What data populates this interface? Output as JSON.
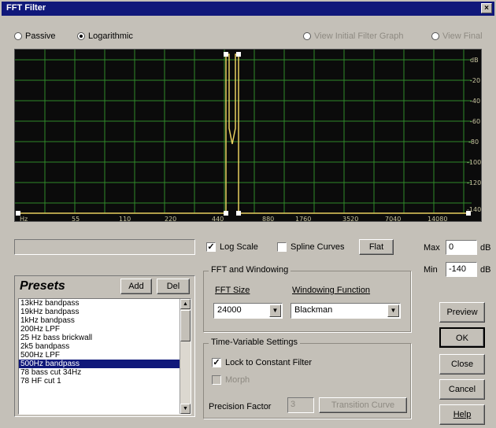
{
  "window": {
    "title": "FFT Filter",
    "close_glyph": "×"
  },
  "top": {
    "passive": "Passive",
    "logarithmic": "Logarithmic",
    "view_initial": "View Initial Filter Graph",
    "view_final": "View Final",
    "selected": "logarithmic"
  },
  "graph": {
    "db_labels": [
      "dB",
      "-20",
      "-40",
      "-60",
      "-80",
      "-100",
      "-120",
      "-140"
    ],
    "freq_labels": [
      "Hz",
      "55",
      "110",
      "220",
      "440",
      "880",
      "1760",
      "3520",
      "7040",
      "14080"
    ],
    "colors": {
      "background": "#0b0b0b",
      "grid": "#2f8a2a",
      "curve": "#e8d060",
      "handle": "#ffffff"
    }
  },
  "controls": {
    "log_scale": {
      "label": "Log Scale",
      "checked": true
    },
    "spline": {
      "label": "Spline Curves",
      "checked": false
    },
    "flat": "Flat",
    "max_label": "Max",
    "max_value": "0",
    "max_unit": "dB",
    "min_label": "Min",
    "min_value": "-140",
    "min_unit": "dB"
  },
  "presets": {
    "title": "Presets",
    "add": "Add",
    "del": "Del",
    "items": [
      "13kHz bandpass",
      "19kHz bandpass",
      "1kHz bandpass",
      "200Hz LPF",
      "25 Hz bass brickwall",
      "2k5 bandpass",
      "500Hz LPF",
      "500Hz bandpass",
      "78 bass cut 34Hz",
      "78 HF cut 1"
    ],
    "selected_index": 7
  },
  "fft": {
    "group": "FFT and Windowing",
    "size_label": "FFT Size",
    "size_value": "24000",
    "window_label": "Windowing Function",
    "window_value": "Blackman"
  },
  "tvs": {
    "group": "Time-Variable Settings",
    "lock_label": "Lock to Constant Filter",
    "lock_checked": true,
    "morph_label": "Morph",
    "precision_label": "Precision Factor",
    "precision_value": "3",
    "transition": "Transition Curve"
  },
  "buttons": {
    "preview": "Preview",
    "ok": "OK",
    "close": "Close",
    "cancel": "Cancel",
    "help": "Help"
  }
}
